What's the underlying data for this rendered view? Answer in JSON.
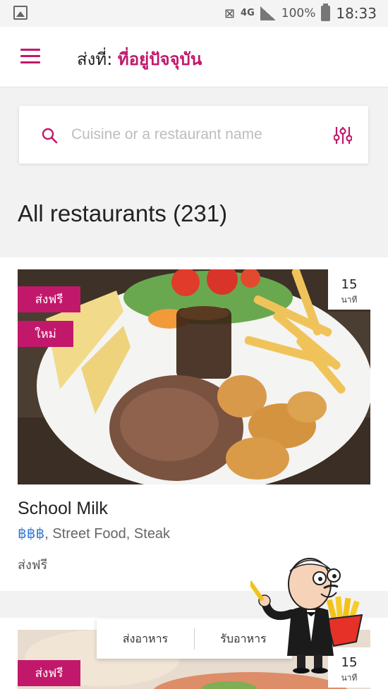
{
  "status_bar": {
    "network": "4G",
    "battery": "100%",
    "time": "18:33"
  },
  "header": {
    "deliver_label": "ส่งที่:",
    "location": "ที่อยู่ปัจจุบัน"
  },
  "search": {
    "placeholder": "Cuisine or a restaurant name"
  },
  "section_title": "All restaurants (231)",
  "restaurants": [
    {
      "badges": [
        "ส่งฟรี",
        "ใหม่"
      ],
      "time_value": "15",
      "time_unit": "นาที",
      "name": "School Milk",
      "price": "฿฿฿",
      "categories": ", Street Food, Steak",
      "delivery": "ส่งฟรี"
    },
    {
      "badges": [
        "ส่งฟรี"
      ],
      "time_value": "15",
      "time_unit": "นาที"
    }
  ],
  "toggle": {
    "delivery": "ส่งอาหาร",
    "pickup": "รับอาหาร"
  },
  "colors": {
    "brand": "#c2186b",
    "price": "#3a7bd5"
  }
}
